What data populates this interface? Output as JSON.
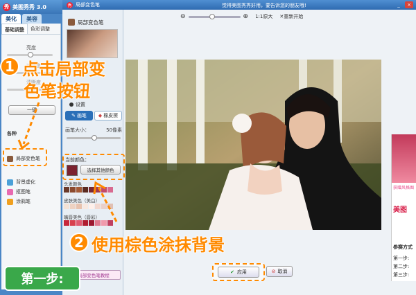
{
  "app": {
    "title": "美图秀秀 3.0",
    "logo_glyph": "秀",
    "tabs": [
      "美化",
      "美容"
    ],
    "active_tab": 0
  },
  "left_panel": {
    "subtabs": [
      "基础调整",
      "色彩调整"
    ],
    "sliders": [
      {
        "label": "亮度"
      },
      {
        "label": "对比度"
      },
      {
        "label": "清晰度"
      }
    ],
    "one_key_button": "一键",
    "section_title": "各种",
    "items": [
      {
        "label": "局部变色笔",
        "icon": "paint-brush-icon",
        "color": "#8a5a3c"
      },
      {
        "label": "背景虚化",
        "icon": "blur-icon",
        "color": "#4aa0d8"
      },
      {
        "label": "抠图笔",
        "icon": "cutout-icon",
        "color": "#e86ab0"
      },
      {
        "label": "涂鸦笔",
        "icon": "doodle-icon",
        "color": "#f0a020"
      }
    ]
  },
  "dialog": {
    "title": "局部变色笔",
    "marquee": "觉得美图秀秀好用，要告诉您的朋友哦!",
    "win_controls": [
      "_",
      "×"
    ]
  },
  "toolbar": {
    "zoom_out": "⊖",
    "zoom_in": "⊕",
    "actual_size": "1:1原大",
    "reset": "✕重新开始"
  },
  "tool_panel": {
    "header": "局部变色笔",
    "settings_label": "设置",
    "brush_tabs": [
      "画笔",
      "橡皮擦"
    ],
    "active_brush_tab": 0,
    "brush_size_label": "画笔大小：",
    "brush_size_value": "50像素",
    "current_color_label": "当前颜色：",
    "current_color": "#7b2230",
    "choose_color_button": "选择其他颜色",
    "palette_groups": [
      {
        "label": "头发颜色",
        "colors": [
          "#6b3a2a",
          "#8c4a2e",
          "#a45a36",
          "#5a2a20",
          "#7a2a34",
          "#a03850",
          "#c24a6a",
          "#d86a90"
        ]
      },
      {
        "label": "皮肤美色（美白）",
        "colors": [
          "#f4e2d6",
          "#eed2c2",
          "#e8c2ae",
          "#f8e8e0",
          "#fff0ea",
          "#f2d8d0",
          "#ead0c8",
          "#e0c0b4"
        ]
      },
      {
        "label": "嘴唇美色（唇彩）",
        "colors": [
          "#c8283c",
          "#d8404e",
          "#e05a70",
          "#b01c30",
          "#9c1830",
          "#e07a90",
          "#f09aac",
          "#c04060"
        ]
      }
    ],
    "tutorial_link": "局部变色笔教程"
  },
  "ad": {
    "brand": "美图",
    "lines": [
      "获赠风格图",
      "参赛方式",
      "第一步:",
      "第二步:",
      "第三步:"
    ]
  },
  "buttons": {
    "apply": "应用",
    "cancel": "取消"
  },
  "annotations": {
    "step1_number": "1",
    "step1_text_line1": "点击局部变",
    "step1_text_line2": "色笔按钮",
    "step2_number": "2",
    "step2_text": "使用棕色涂抹背景",
    "step_badge": "第一步:"
  },
  "colors": {
    "accent": "#ff8a00",
    "title_bar": "#3a76b8",
    "badge": "#3aa84a"
  }
}
